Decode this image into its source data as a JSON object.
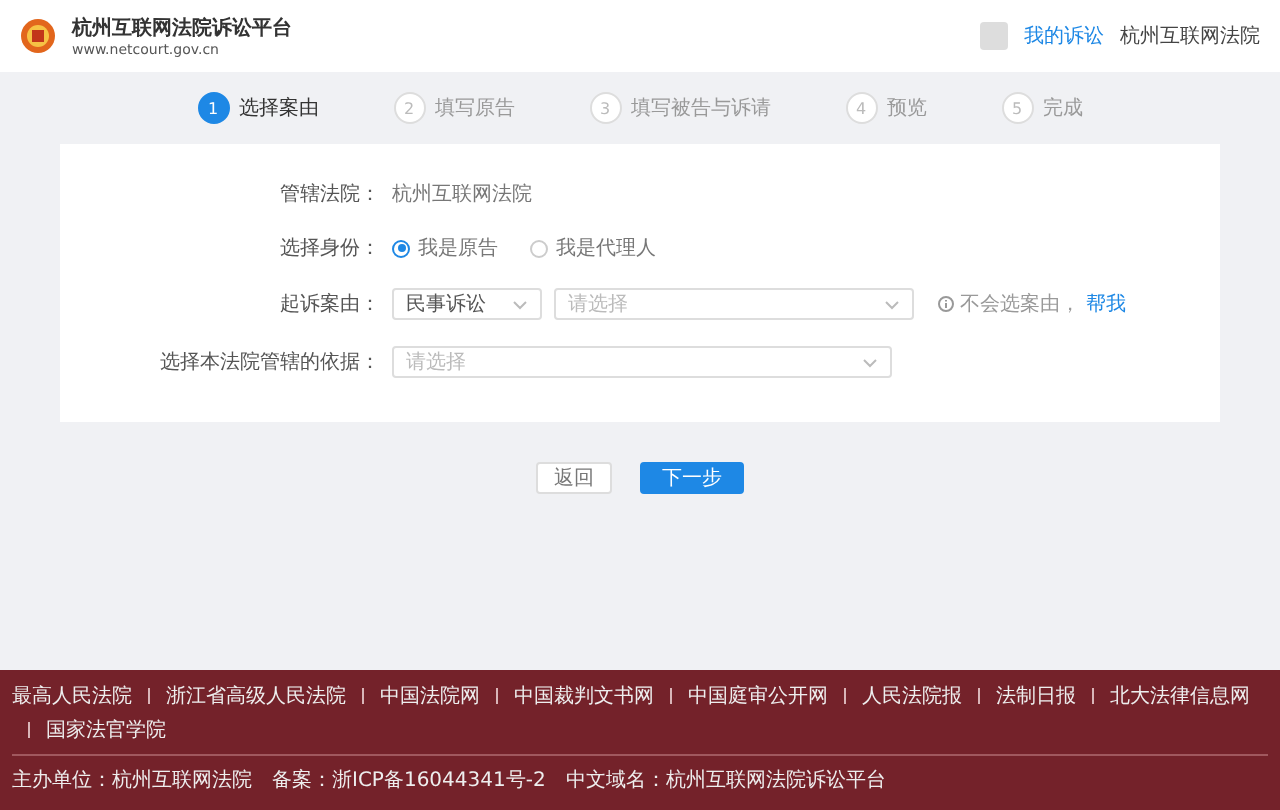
{
  "header": {
    "title": "杭州互联网法院诉讼平台",
    "url": "www.netcourt.gov.cn",
    "links": [
      {
        "label": "我的诉讼",
        "kind": "link"
      },
      {
        "label": "杭州互联网法院",
        "kind": "text"
      }
    ]
  },
  "steps": [
    {
      "number": "1",
      "label": "选择案由",
      "selected": true
    },
    {
      "number": "2",
      "label": "填写原告",
      "selected": false
    },
    {
      "number": "3",
      "label": "填写被告与诉请",
      "selected": false
    },
    {
      "number": "4",
      "label": "预览",
      "selected": false
    },
    {
      "number": "5",
      "label": "完成",
      "selected": false
    }
  ],
  "form": {
    "court": {
      "label": "管辖法院：",
      "value": "杭州互联网法院"
    },
    "identity": {
      "label": "选择身份：",
      "options": [
        {
          "label": "我是原告",
          "selected": true
        },
        {
          "label": "我是代理人",
          "selected": false
        }
      ]
    },
    "cause": {
      "label": "起诉案由：",
      "selects": [
        {
          "value": "民事诉讼"
        },
        {
          "placeholder": "请选择"
        }
      ],
      "hint": "不会选案由，",
      "hint_link": "帮我"
    },
    "basis": {
      "label": "选择本法院管辖的依据：",
      "placeholder": "请选择"
    }
  },
  "buttons": [
    {
      "label": "返回",
      "kind": "secondary"
    },
    {
      "label": "下一步",
      "kind": "primary"
    }
  ],
  "footer": {
    "links": [
      "最高人民法院",
      "浙江省高级人民法院",
      "中国法院网",
      "中国裁判文书网",
      "中国庭审公开网",
      "人民法院报",
      "法制日报",
      "北大法律信息网",
      "国家法官学院"
    ],
    "info": [
      "主办单位：杭州互联网法院",
      "备案：浙ICP备16044341号-2",
      "中文域名：杭州互联网法院诉讼平台"
    ]
  }
}
